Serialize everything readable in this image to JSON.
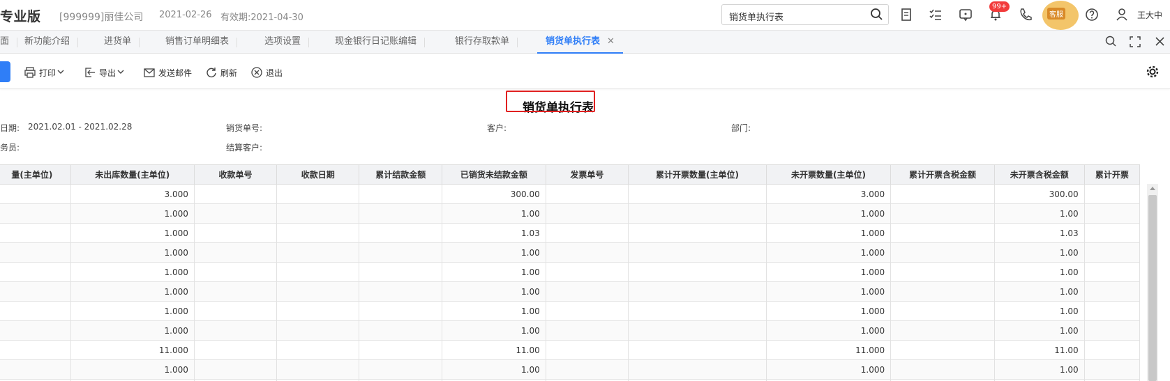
{
  "header": {
    "brand": "专业版",
    "company": "[999999]丽佳公司",
    "date": "2021-02-26",
    "expire": "有效期:2021-04-30",
    "search_value": "销货单执行表",
    "notification_badge": "99+",
    "service_label": "客服",
    "username": "王大中"
  },
  "tabs": [
    {
      "label": "面"
    },
    {
      "label": "新功能介绍"
    },
    {
      "label": "进货单"
    },
    {
      "label": "销售订单明细表"
    },
    {
      "label": "选项设置"
    },
    {
      "label": "现金银行日记账编辑"
    },
    {
      "label": "银行存取款单"
    },
    {
      "label": "销货单执行表",
      "active": true,
      "close": "✕"
    }
  ],
  "toolbar": {
    "print": "打印",
    "export": "导出",
    "send_mail": "发送邮件",
    "refresh": "刷新",
    "exit": "退出"
  },
  "report": {
    "title": "销货单执行表",
    "filters": {
      "date_label": "日期:",
      "date_value": "2021.02.01 - 2021.02.28",
      "sales_no_label": "销货单号:",
      "customer_label": "客户:",
      "dept_label": "部门:",
      "salesman_label": "务员:",
      "settle_customer_label": "结算客户:"
    }
  },
  "table": {
    "columns": [
      "量(主单位)",
      "未出库数量(主单位)",
      "收款单号",
      "收款日期",
      "累计结款金额",
      "已销货未结款金额",
      "发票单号",
      "累计开票数量(主单位)",
      "未开票数量(主单位)",
      "累计开票含税金额",
      "未开票含税金额",
      "累计开票"
    ],
    "rows": [
      [
        "",
        "3.000",
        "",
        "",
        "",
        "300.00",
        "",
        "",
        "3.000",
        "",
        "300.00",
        ""
      ],
      [
        "",
        "1.000",
        "",
        "",
        "",
        "1.00",
        "",
        "",
        "1.000",
        "",
        "1.00",
        ""
      ],
      [
        "",
        "1.000",
        "",
        "",
        "",
        "1.03",
        "",
        "",
        "1.000",
        "",
        "1.03",
        ""
      ],
      [
        "",
        "1.000",
        "",
        "",
        "",
        "1.00",
        "",
        "",
        "1.000",
        "",
        "1.00",
        ""
      ],
      [
        "",
        "1.000",
        "",
        "",
        "",
        "1.00",
        "",
        "",
        "1.000",
        "",
        "1.00",
        ""
      ],
      [
        "",
        "1.000",
        "",
        "",
        "",
        "1.00",
        "",
        "",
        "1.000",
        "",
        "1.00",
        ""
      ],
      [
        "",
        "1.000",
        "",
        "",
        "",
        "1.00",
        "",
        "",
        "1.000",
        "",
        "1.00",
        ""
      ],
      [
        "",
        "1.000",
        "",
        "",
        "",
        "1.00",
        "",
        "",
        "1.000",
        "",
        "1.00",
        ""
      ],
      [
        "",
        "11.000",
        "",
        "",
        "",
        "11.00",
        "",
        "",
        "11.000",
        "",
        "11.00",
        ""
      ],
      [
        "",
        "1.000",
        "",
        "",
        "",
        "1.00",
        "",
        "",
        "1.000",
        "",
        "1.00",
        ""
      ],
      [
        "",
        "",
        "",
        "",
        "",
        "",
        "",
        "",
        "",
        "",
        "",
        ""
      ]
    ]
  },
  "colors": {
    "accent": "#2f7ef7",
    "highlight_box": "#e12121",
    "badge": "#f23b3b"
  }
}
